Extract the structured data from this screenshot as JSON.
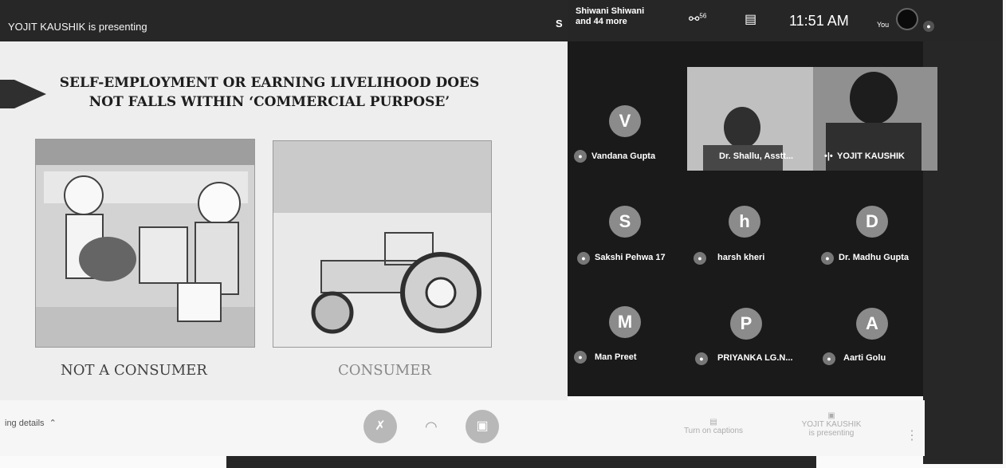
{
  "header": {
    "presenter_text": "YOJIT KAUSHIK is presenting",
    "initial": "S",
    "participants_text": [
      "Shiwani Shiwani",
      "and 44 more"
    ],
    "participant_count": "56",
    "time": "11:51 AM",
    "self_label": "You"
  },
  "slide": {
    "title_line1": "SELF-EMPLOYMENT OR EARNING LIVELIHOOD DOES",
    "title_line2": "NOT FALLS WITHIN ‘COMMERCIAL PURPOSE’",
    "caption_left": "NOT A CONSUMER",
    "caption_right": "CONSUMER"
  },
  "tiles": [
    {
      "initial": "V",
      "name": "Vandana Gupta"
    },
    {
      "initial": "",
      "name": "Dr. Shallu, Asstt..."
    },
    {
      "initial": "",
      "name": "YOJIT KAUSHIK"
    },
    {
      "initial": "S",
      "name": "Sakshi Pehwa 17"
    },
    {
      "initial": "h",
      "name": "harsh kheri"
    },
    {
      "initial": "D",
      "name": "Dr. Madhu Gupta"
    },
    {
      "initial": "M",
      "name": "Man Preet"
    },
    {
      "initial": "P",
      "name": "PRIYANKA LG.N..."
    },
    {
      "initial": "A",
      "name": "Aarti Golu"
    }
  ],
  "footer": {
    "meeting_details": "ing details",
    "captions_label": "Turn on captions",
    "presenting_label": [
      "YOJIT KAUSHIK",
      "is presenting"
    ],
    "more_glyph": "⋮"
  },
  "colors": {
    "accent": "#8a8a8a"
  }
}
